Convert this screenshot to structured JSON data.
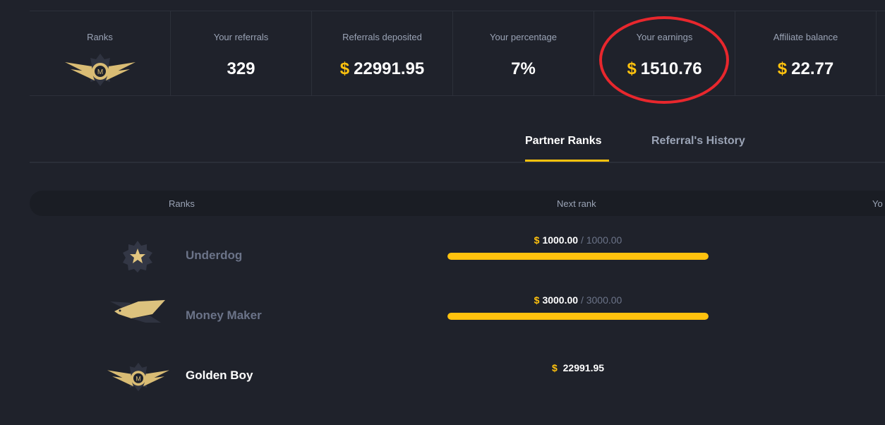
{
  "stats": [
    {
      "label": "Ranks",
      "icon": "golden-boy-rank-icon"
    },
    {
      "label": "Your referrals",
      "value": "329"
    },
    {
      "label": "Referrals deposited",
      "currency": "$",
      "value": "22991.95"
    },
    {
      "label": "Your percentage",
      "value": "7%"
    },
    {
      "label": "Your earnings",
      "currency": "$",
      "value": "1510.76"
    },
    {
      "label": "Affiliate balance",
      "currency": "$",
      "value": "22.77"
    }
  ],
  "tabs": [
    {
      "label": "Partner Ranks",
      "active": true
    },
    {
      "label": "Referral's History",
      "active": false
    }
  ],
  "table": {
    "headers": [
      "Ranks",
      "Next rank",
      "Yo"
    ],
    "rows": [
      {
        "name": "Underdog",
        "icon": "star-badge-icon",
        "currency": "$",
        "current": "1000.00",
        "target": "/ 1000.00",
        "progress": 1.0
      },
      {
        "name": "Money Maker",
        "icon": "eagle-icon",
        "currency": "$",
        "current": "3000.00",
        "target": "/ 3000.00",
        "progress": 1.0
      },
      {
        "name": "Golden Boy",
        "icon": "winged-emblem-icon",
        "currency": "$",
        "current": "22991.95"
      }
    ]
  },
  "colors": {
    "accent": "#ffc20e",
    "highlight_circle": "#e8272d",
    "background": "#1f222b"
  }
}
